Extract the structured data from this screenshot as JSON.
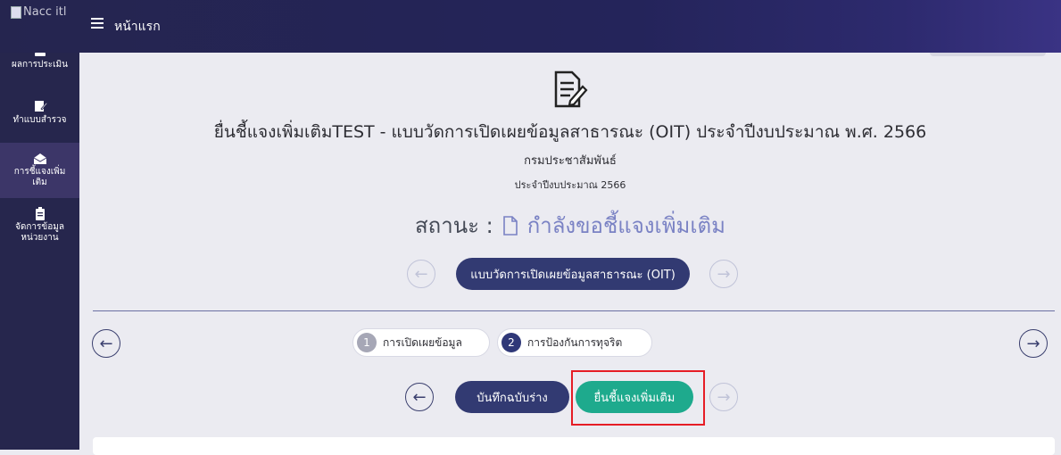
{
  "topbar": {
    "logo_alt": "Nacc itl",
    "home_label": "หน้าแรก"
  },
  "sidebar": {
    "items": [
      {
        "label": "ผลการประเมิน",
        "icon": "chart-icon",
        "active": false
      },
      {
        "label": "ทำแบบสำรวจ",
        "icon": "edit-form-icon",
        "active": false
      },
      {
        "label": "การชี้แจงเพิ่มเติม",
        "icon": "envelope-open-icon",
        "active": true
      },
      {
        "label": "จัดการข้อมูลหน่วยงาน",
        "icon": "clipboard-icon",
        "active": false
      }
    ]
  },
  "main": {
    "title": "ยื่นชี้แจงเพิ่มเติมTEST - แบบวัดการเปิดเผยข้อมูลสาธารณะ (OIT) ประจำปีงบประมาณ พ.ศ. 2566",
    "org": "กรมประชาสัมพันธ์",
    "fiscal_year": "ประจำปีงบประมาณ 2566",
    "status_label": "สถานะ :",
    "status_value": "กำลังขอชี้แจงเพิ่มเติม",
    "survey_pill": "แบบวัดการเปิดเผยข้อมูลสาธารณะ (OIT)",
    "steps": [
      {
        "num": "1",
        "label": "การเปิดเผยข้อมูล"
      },
      {
        "num": "2",
        "label": "การป้องกันการทุจริต"
      }
    ],
    "save_draft": "บันทึกฉบับร่าง",
    "submit": "ยื่นชี้แจงเพิ่มเติม"
  },
  "colors": {
    "navy": "#26264d",
    "accent_blue": "#323a72",
    "green": "#1eaa8d",
    "status_blue": "#7a82c4",
    "highlight_red": "#e61d26"
  }
}
